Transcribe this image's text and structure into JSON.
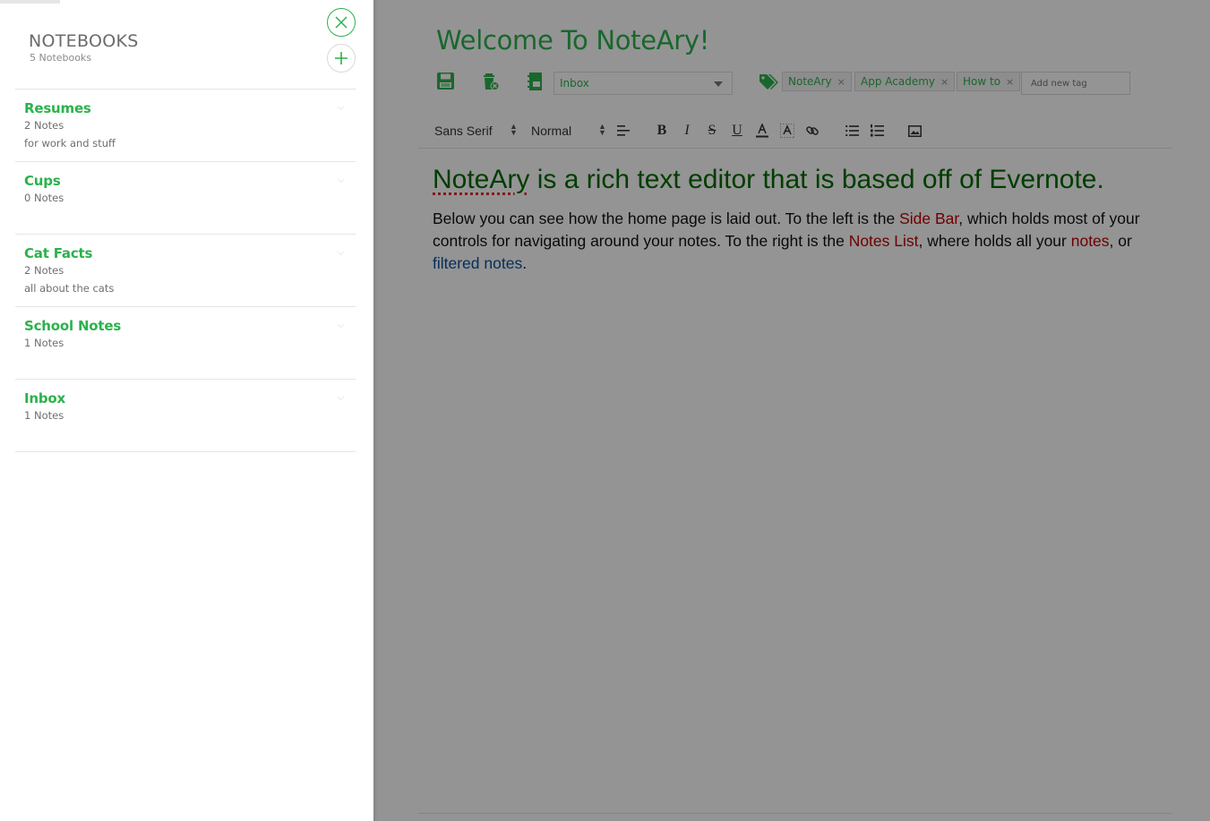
{
  "sidebar": {
    "heading": "NOTEBOOKS",
    "count": "5 Notebooks",
    "notebooks": [
      {
        "title": "Resumes",
        "notes": "2 Notes",
        "desc": "for work and stuff"
      },
      {
        "title": "Cups",
        "notes": "0 Notes",
        "desc": ""
      },
      {
        "title": "Cat Facts",
        "notes": "2 Notes",
        "desc": "all about the cats"
      },
      {
        "title": "School Notes",
        "notes": "1 Notes",
        "desc": ""
      },
      {
        "title": "Inbox",
        "notes": "1 Notes",
        "desc": ""
      }
    ]
  },
  "note": {
    "title": "Welcome To NoteAry!",
    "notebook_selected": "Inbox",
    "tags": [
      "NoteAry",
      "App Academy",
      "How to"
    ],
    "tag_placeholder": "Add new tag",
    "tag_remove_glyph": "×"
  },
  "format_bar": {
    "font": "Sans Serif",
    "size": "Normal",
    "bold": "B",
    "italic": "I",
    "strike": "S",
    "underline": "U"
  },
  "editor": {
    "heading_word": "NoteAry",
    "heading_rest": " is a rich text editor that is based off of Evernote.",
    "p1": "Below you can see how the home page is laid out. To the left is the ",
    "p_sidebar": "Side Bar",
    "p2": ", which holds most of your controls for navigating around your notes. To the right is the ",
    "p_noteslist": "Notes List",
    "p3": ", where holds all your ",
    "p_notes": "notes",
    "p4": ", or ",
    "p_filtered": "filtered notes",
    "p5": "."
  },
  "colors": {
    "accent": "#2bb24c",
    "heading_green": "#006a00",
    "link_red": "#c00000",
    "link_blue": "#0b4f9e"
  },
  "icons": [
    "close-icon",
    "plus-icon",
    "save-icon",
    "trash-icon",
    "notebook-icon",
    "tags-icon",
    "align-left-icon",
    "text-color-icon",
    "highlight-icon",
    "link-icon",
    "bullet-list-icon",
    "ordered-list-icon",
    "image-icon"
  ]
}
